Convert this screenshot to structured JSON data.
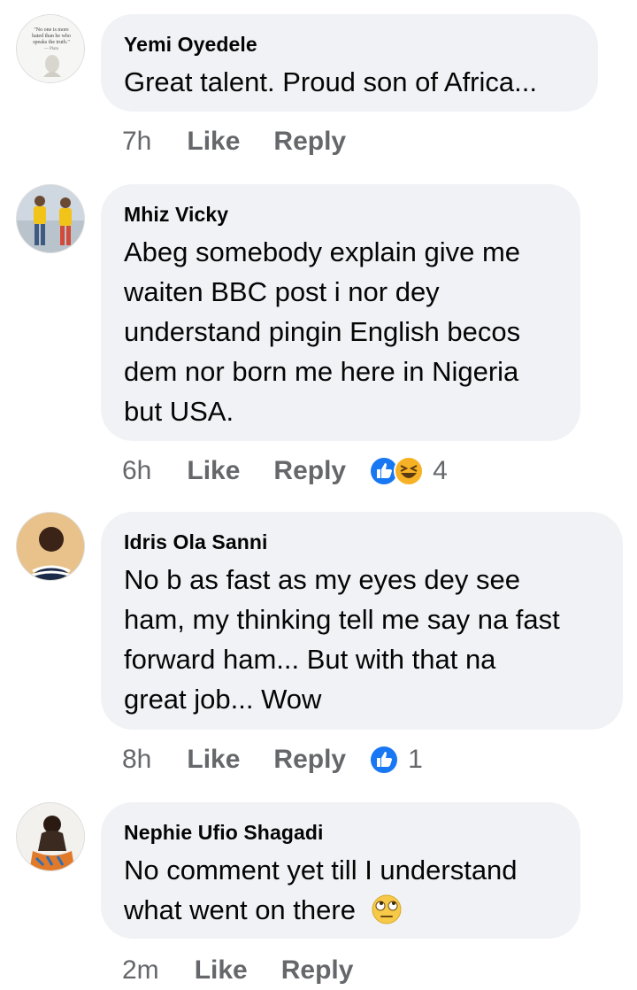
{
  "colors": {
    "bubble": "#f0f2f5",
    "meta": "#65676b",
    "like_blue": "#1877f2",
    "haha_yellow": "#f7b125"
  },
  "comments": [
    {
      "name": "Yemi Oyedele",
      "text": [
        "Great talent. Proud son of Africa..."
      ],
      "time": "7h",
      "like": "Like",
      "reply": "Reply",
      "avatar_quote": "\"No one is more hated than he who speaks the truth.\"",
      "avatar_author": "— Plato"
    },
    {
      "name": "Mhiz Vicky",
      "text": [
        "Abeg somebody explain give me",
        "waiten BBC post i nor dey",
        "understand pingin English becos",
        "dem nor born me here in Nigeria",
        "but USA."
      ],
      "time": "6h",
      "like": "Like",
      "reply": "Reply",
      "reactions": [
        "like-icon",
        "haha-icon"
      ],
      "count": "4"
    },
    {
      "name": "Idris Ola Sanni",
      "text": [
        "No b as fast as my eyes dey see",
        "ham, my thinking tell me say na fast",
        "forward ham... But with that na",
        "great job... Wow"
      ],
      "time": "8h",
      "like": "Like",
      "reply": "Reply",
      "reactions": [
        "like-icon"
      ],
      "count": "1"
    },
    {
      "name": "Nephie Ufio Shagadi",
      "text": [
        "No comment yet till I understand",
        "what went on there"
      ],
      "emoji": "eye-roll-emoji",
      "time": "2m",
      "like": "Like",
      "reply": "Reply"
    }
  ]
}
